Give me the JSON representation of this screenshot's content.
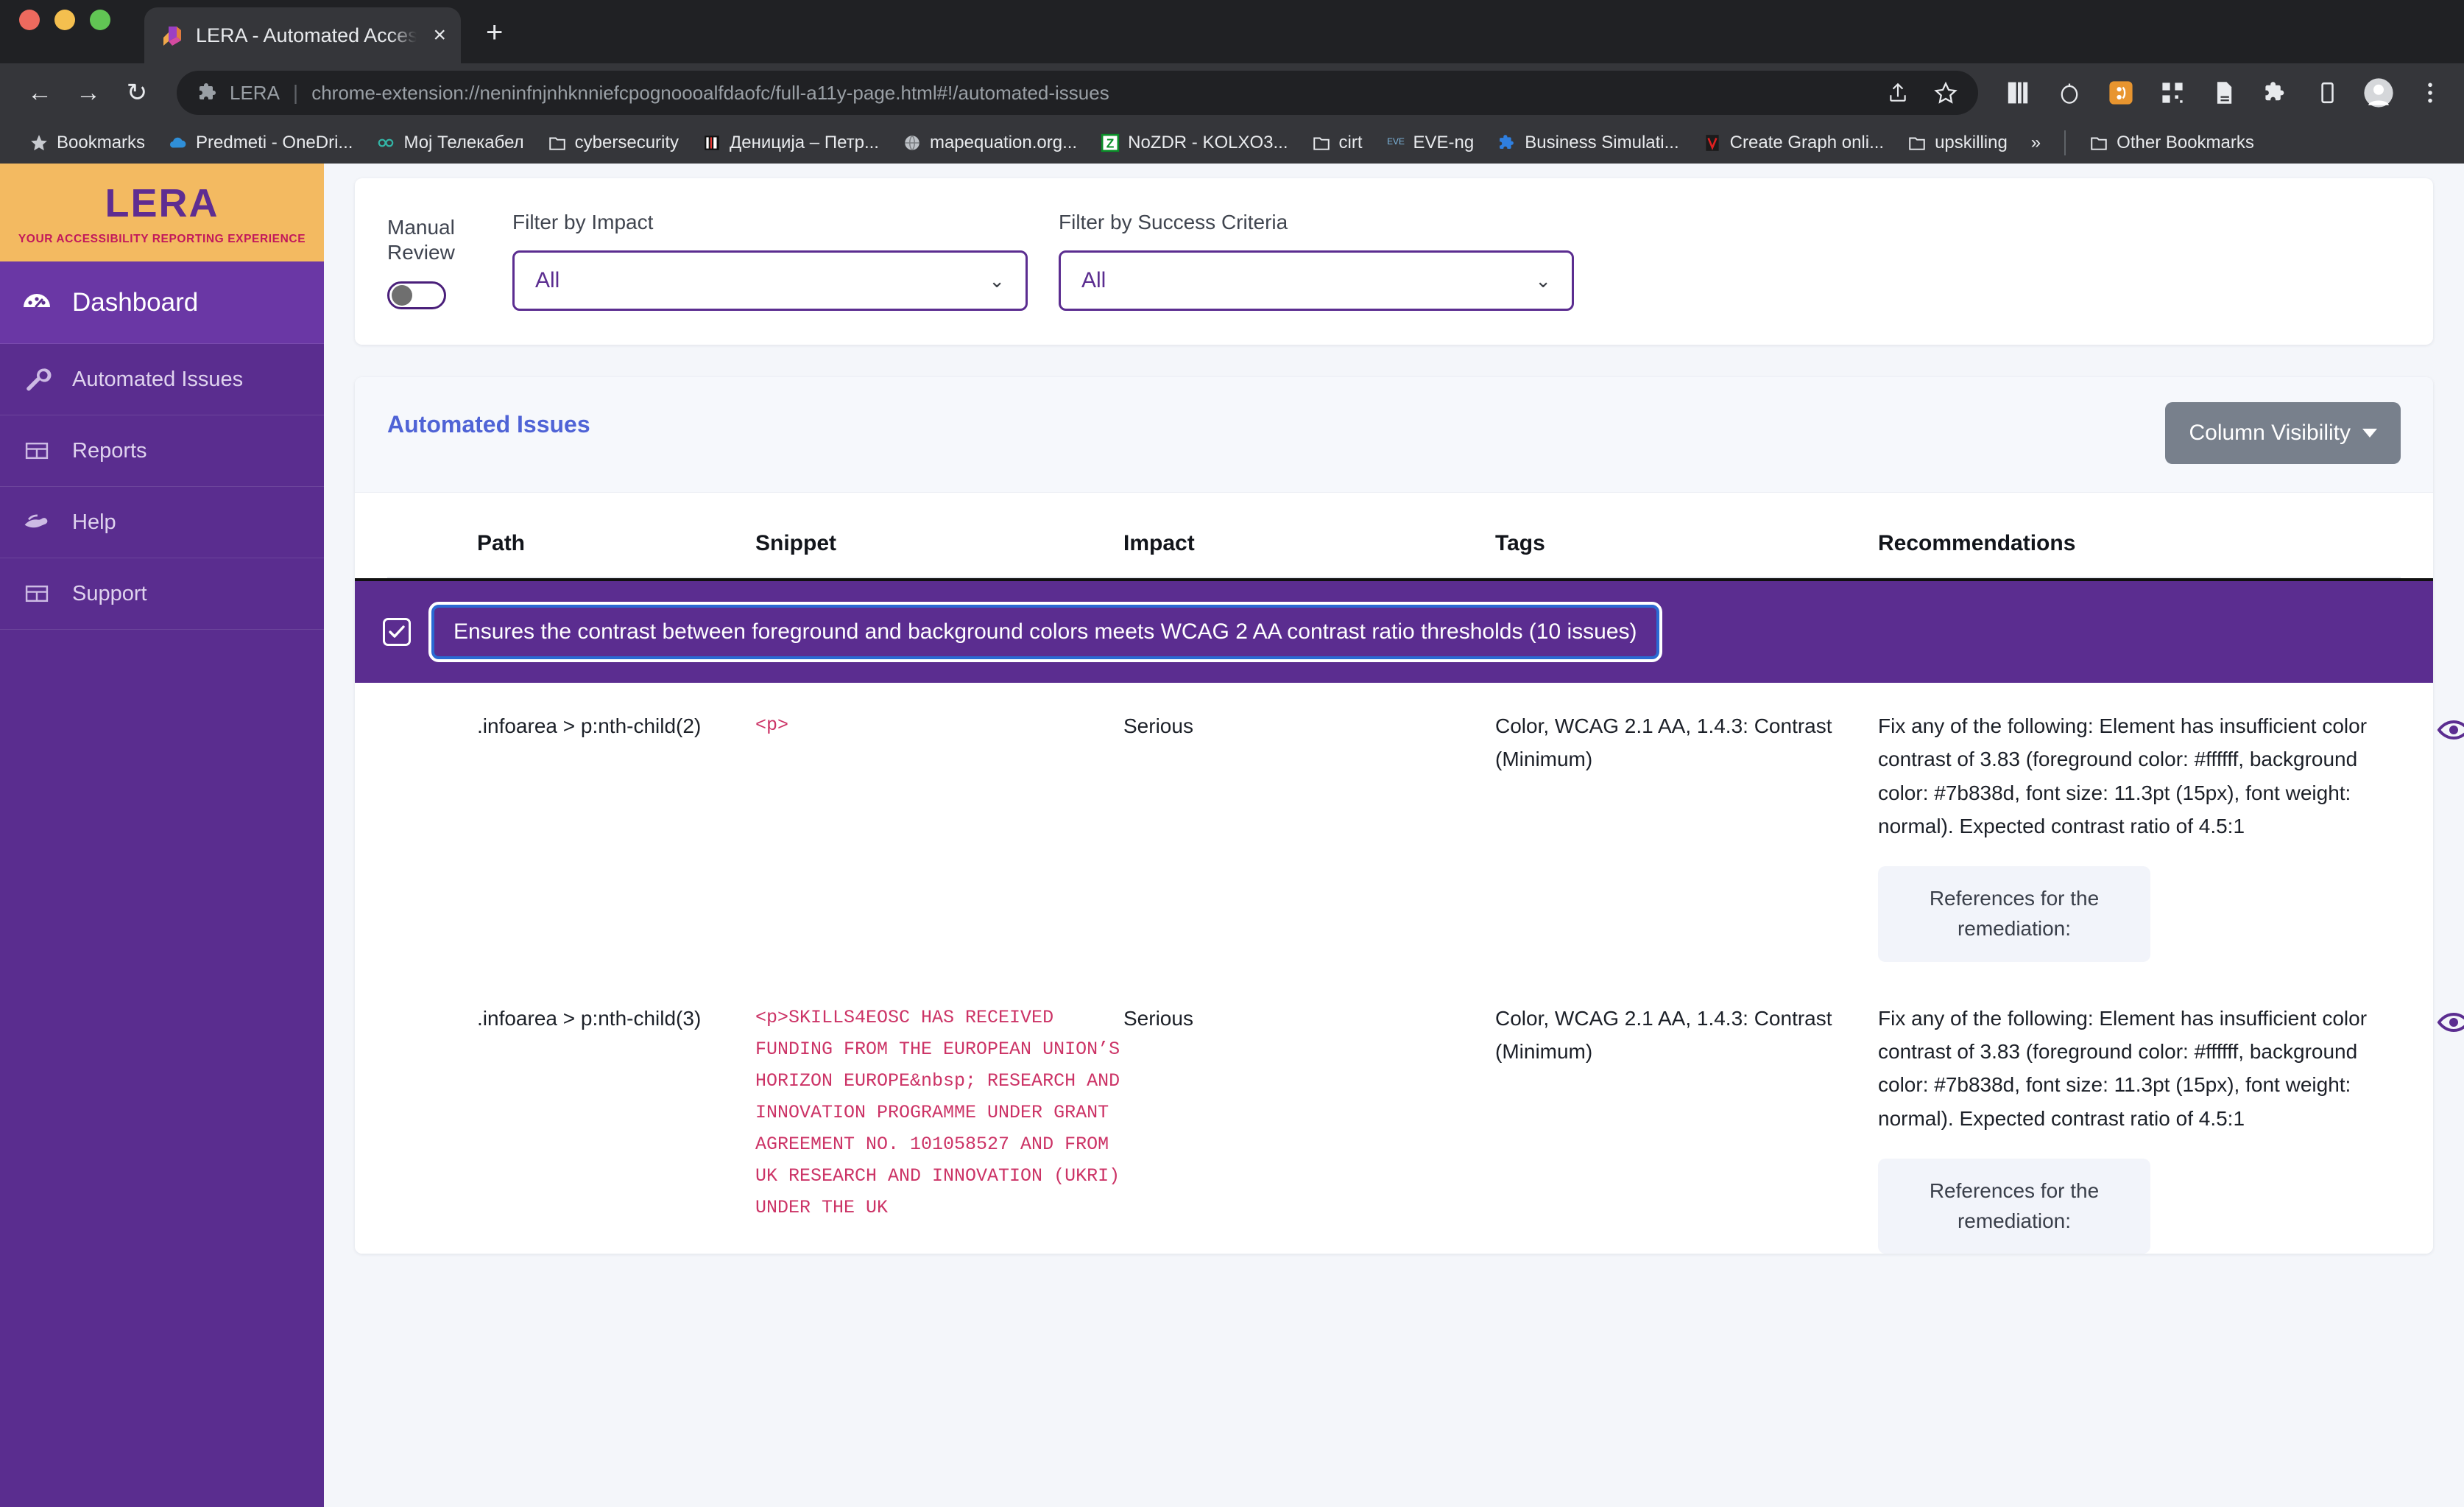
{
  "browser": {
    "tab": {
      "title": "LERA - Automated Accessibility",
      "favicon": "lera-logo-icon",
      "close": "×"
    },
    "new_tab_label": "+",
    "nav": {
      "back": "←",
      "forward": "→",
      "reload": "↻"
    },
    "omnibox": {
      "extension_icon": "puzzle-piece-icon",
      "extension_name": "LERA",
      "separator": "|",
      "url": "chrome-extension://neninfnjnhknniefcpognoooalfdaofc/full-a11y-page.html#!/automated-issues",
      "share_icon": "share-icon",
      "bookmark_icon": "star-icon"
    },
    "toolbar_icons": [
      "reading-list-icon",
      "timer-icon",
      "lera-extension-icon",
      "qr-code-icon",
      "document-icon",
      "extensions-puzzle-icon",
      "device-icon",
      "profile-avatar-icon",
      "chrome-menu-icon"
    ],
    "bookmarks": [
      {
        "label": "Bookmarks",
        "icon": "star-icon"
      },
      {
        "label": "Predmeti - OneDri...",
        "icon": "onedrive-icon"
      },
      {
        "label": "Мој Телекабел",
        "icon": "infinity-icon"
      },
      {
        "label": "cybersecurity",
        "icon": "folder-icon"
      },
      {
        "label": "Дениција – Петр...",
        "icon": "site-icon"
      },
      {
        "label": "mapequation.org...",
        "icon": "globe-icon"
      },
      {
        "label": "NoZDR - KOLXO3...",
        "icon": "z-icon"
      },
      {
        "label": "cirt",
        "icon": "folder-icon"
      },
      {
        "label": "EVE-ng",
        "icon": "eveng-icon"
      },
      {
        "label": "Business Simulati...",
        "icon": "puzzle-icon"
      },
      {
        "label": "Create Graph onli...",
        "icon": "v-icon"
      },
      {
        "label": "upskilling",
        "icon": "folder-icon"
      }
    ],
    "bookmarks_overflow": "»",
    "other_bookmarks": {
      "label": "Other Bookmarks",
      "icon": "folder-icon"
    }
  },
  "sidebar": {
    "logo": {
      "title": "LERA",
      "tagline": "YOUR ACCESSIBILITY REPORTING EXPERIENCE"
    },
    "items": [
      {
        "label": "Dashboard",
        "icon": "dashboard-gauge-icon",
        "active": true
      },
      {
        "label": "Automated Issues",
        "icon": "wrench-icon",
        "active": false
      },
      {
        "label": "Reports",
        "icon": "table-icon",
        "active": false
      },
      {
        "label": "Help",
        "icon": "helping-hands-icon",
        "active": false
      },
      {
        "label": "Support",
        "icon": "table-icon",
        "active": false
      }
    ]
  },
  "filters": {
    "manual_review_label_line1": "Manual",
    "manual_review_label_line2": "Review",
    "manual_review_state": "off",
    "impact": {
      "label": "Filter by Impact",
      "value": "All",
      "caret": "⌄"
    },
    "success_criteria": {
      "label": "Filter by Success Criteria",
      "value": "All",
      "caret": "⌄"
    }
  },
  "issues": {
    "title": "Automated Issues",
    "column_visibility_label": "Column Visibility",
    "columns": [
      "Path",
      "Snippet",
      "Impact",
      "Tags",
      "Recommendations"
    ],
    "group": {
      "checked": true,
      "label": "Ensures the contrast between foreground and background colors meets WCAG 2 AA contrast ratio thresholds (10 issues)"
    },
    "rows": [
      {
        "path": ".infoarea > p:nth-child(2)",
        "snippet": "<p>",
        "impact": "Serious",
        "tags": "Color, WCAG 2.1 AA, 1.4.3: Contrast (Minimum)",
        "recommendation": "Fix any of the following: Element has insufficient color contrast of 3.83 (foreground color: #ffffff, background color: #7b838d, font size: 11.3pt (15px), font weight: normal). Expected contrast ratio of 4.5:1",
        "references_button": "References for the remediation:",
        "view_icon": "eye-icon"
      },
      {
        "path": ".infoarea > p:nth-child(3)",
        "snippet": "<p>SKILLS4EOSC HAS RECEIVED FUNDING FROM THE EUROPEAN UNION’S HORIZON EUROPE&nbsp; RESEARCH AND INNOVATION PROGRAMME UNDER GRANT AGREEMENT NO. 101058527 AND FROM UK RESEARCH AND INNOVATION (UKRI) UNDER THE UK",
        "impact": "Serious",
        "tags": "Color, WCAG 2.1 AA, 1.4.3: Contrast (Minimum)",
        "recommendation": "Fix any of the following: Element has insufficient color contrast of 3.83 (foreground color: #ffffff, background color: #7b838d, font size: 11.3pt (15px), font weight: normal). Expected contrast ratio of 4.5:1",
        "references_button": "References for the remediation:",
        "view_icon": "eye-icon"
      }
    ]
  },
  "colors": {
    "brand_purple": "#5b2d90",
    "sidebar_purple": "#5a2d8f",
    "logo_amber": "#f3ba61",
    "logo_magenta": "#c2185b",
    "link_blue": "#4f63d6",
    "snippet_pink": "#cc3366",
    "button_gray": "#78808c"
  }
}
